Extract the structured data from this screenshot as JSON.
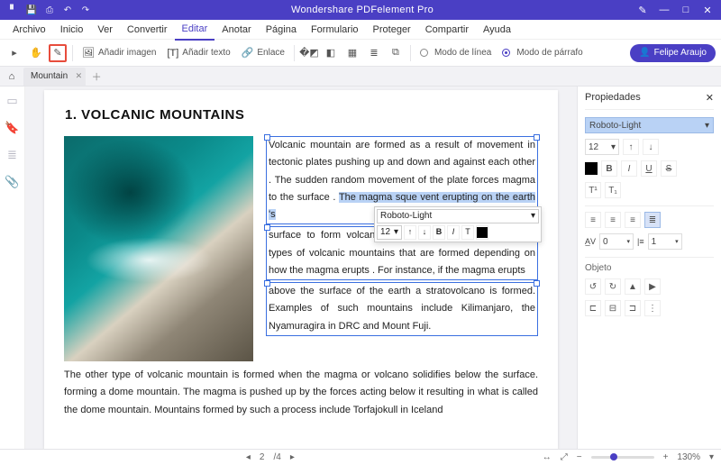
{
  "app": {
    "title": "Wondershare PDFelement Pro"
  },
  "menubar": {
    "items": [
      "Archivo",
      "Inicio",
      "Ver",
      "Convertir",
      "Editar",
      "Anotar",
      "Página",
      "Formulario",
      "Proteger",
      "Compartir",
      "Ayuda"
    ],
    "active": "Editar"
  },
  "toolbar": {
    "add_image": "Añadir imagen",
    "add_text": "Añadir texto",
    "link": "Enlace",
    "mode_line": "Modo de línea",
    "mode_para": "Modo de párrafo",
    "user": "Felipe Araujo"
  },
  "tabs": {
    "t0": "Mountain"
  },
  "doc": {
    "heading": "1. VOLCANIC MOUNTAINS",
    "p1a": "Volcanic mountain are formed as a result of movement in tectonic plates pushing up and down and against each other . The sudden random movement  of the plate forces magma to the surface . ",
    "p1_sel": "The magma sque vent erupting on the earth 's",
    "p1b": "surface to form volcanic mountains . There are different types of volcanic mountains that are formed depending on how the magma erupts . For instance, if the magma erupts",
    "p1c": "above the surface of the earth a stratovolcano is formed. Examples of such mountains include Kilimanjaro, the Nyamuragira in DRC and Mount Fuji.",
    "p2": "The other type of volcanic mountain is formed when the magma or volcano solidifies below the surface. forming a dome mountain. The magma is pushed up by the forces acting below it resulting in what is called the dome mountain. Mountains formed by such a process include Torfajokull in Iceland"
  },
  "fontpop": {
    "font": "Roboto-Light",
    "size": "12"
  },
  "panel": {
    "title": "Propiedades",
    "font": "Roboto-Light",
    "size": "12",
    "char_spacing": "0",
    "line_spacing": "1",
    "section_object": "Objeto"
  },
  "status": {
    "page_current": "2",
    "page_sep": "/4",
    "zoom": "130%"
  }
}
